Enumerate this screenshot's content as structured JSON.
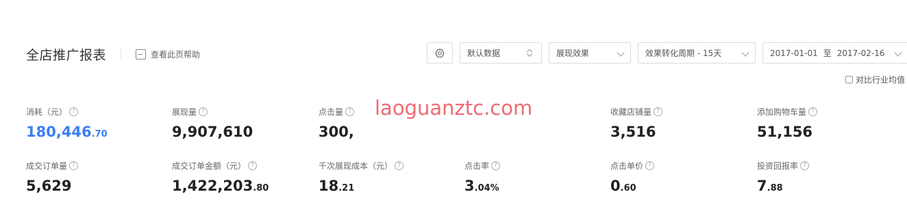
{
  "header": {
    "title": "全店推广报表",
    "help_label": "查看此页帮助"
  },
  "controls": {
    "data_select": "默认数据",
    "display_select": "展现效果",
    "period_select": "效果转化周期 - 15天",
    "date_start": "2017-01-01",
    "date_sep": "至",
    "date_end": "2017-02-16",
    "compare_label": "对比行业均值",
    "compare_checked": false
  },
  "watermark": "laoguanztc.com",
  "metrics": [
    {
      "label": "消耗（元）",
      "int": "180,446",
      "dec": ".70",
      "highlight": true
    },
    {
      "label": "展现量",
      "int": "9,907,610",
      "dec": ""
    },
    {
      "label": "点击量",
      "int": "300,",
      "dec": ""
    },
    {
      "label": "收藏店铺量",
      "int": "3,516",
      "dec": ""
    },
    {
      "label": "添加购物车量",
      "int": "51,156",
      "dec": ""
    },
    {
      "label": "成交订单量",
      "int": "5,629",
      "dec": ""
    },
    {
      "label": "成交订单金额（元）",
      "int": "1,422,203",
      "dec": ".80"
    },
    {
      "label": "千次展现成本（元）",
      "int": "18",
      "dec": ".21"
    },
    {
      "label": "点击率",
      "int": "3",
      "dec": ".04%"
    },
    {
      "label": "点击单价",
      "int": "0",
      "dec": ".60"
    },
    {
      "label": "投资回报率",
      "int": "7",
      "dec": ".88"
    }
  ],
  "icons": {
    "help": "help-doc-icon",
    "settings": "gear-icon",
    "info": "question-icon"
  },
  "colors": {
    "accent": "#3a7ff5",
    "watermark": "#ec6b73"
  }
}
